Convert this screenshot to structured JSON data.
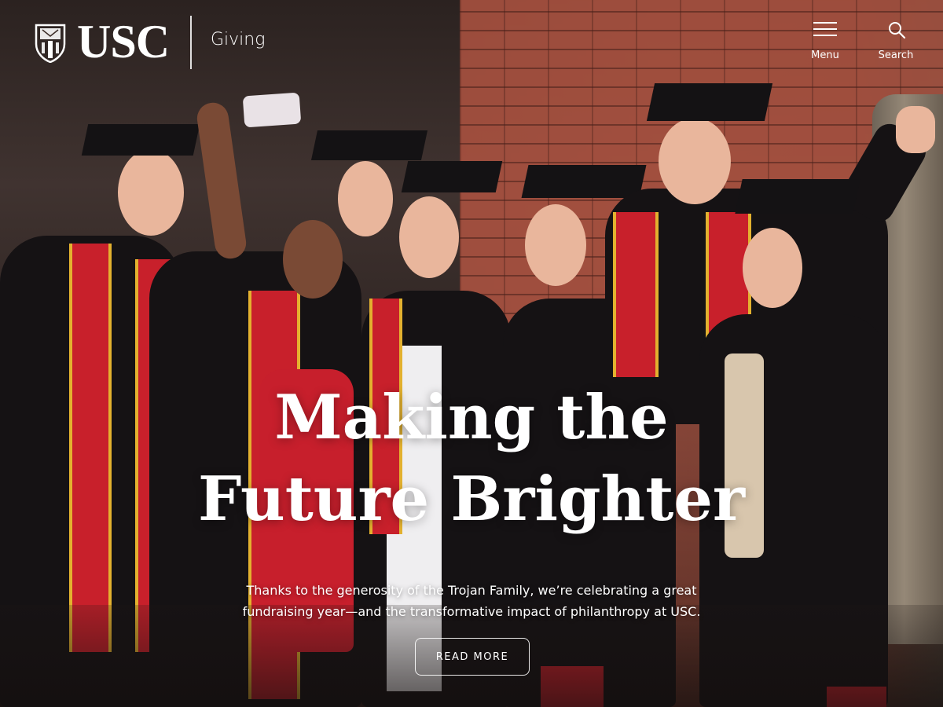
{
  "header": {
    "logo_text": "USC",
    "logo_subtitle": "Giving",
    "menu_label": "Menu",
    "search_label": "Search"
  },
  "hero": {
    "headline_line1": "Making the",
    "headline_line2": "Future Brighter",
    "subcopy": "Thanks to the generosity of the Trojan Family, we’re celebrating a great fundraising year—and the transformative impact of philanthropy at USC.",
    "cta_label": "READ MORE"
  },
  "colors": {
    "accent_cardinal": "#990000",
    "accent_gold": "#FFCC00",
    "text": "#FFFFFF"
  },
  "icons": [
    "usc-seal-icon",
    "hamburger-menu-icon",
    "search-icon"
  ]
}
